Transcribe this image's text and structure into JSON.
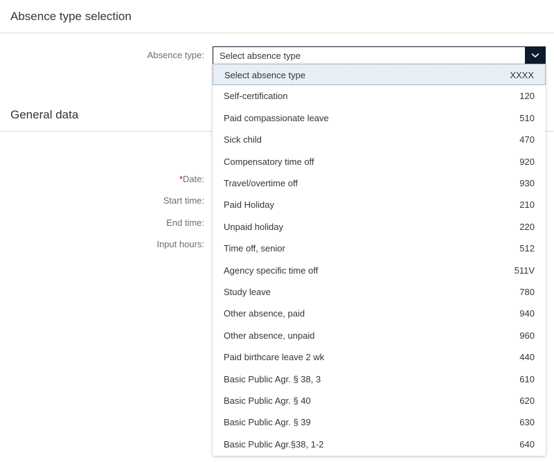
{
  "sections": {
    "absence_type_selection": "Absence type selection",
    "general_data": "General data"
  },
  "form": {
    "absence_type_label": "Absence type:",
    "date_required_marker": "*",
    "date_label": "Date:",
    "start_time_label": "Start time:",
    "end_time_label": "End time:",
    "input_hours_label": "Input hours:"
  },
  "absence_select": {
    "value": "Select absence type",
    "arrow_icon": "chevron-down-icon",
    "expanded": true,
    "options": [
      {
        "text": "Select absence type",
        "key": "XXXX",
        "selected": true
      },
      {
        "text": "Self-certification",
        "key": "120"
      },
      {
        "text": "Paid compassionate leave",
        "key": "510"
      },
      {
        "text": "Sick child",
        "key": "470"
      },
      {
        "text": "Compensatory time off",
        "key": "920"
      },
      {
        "text": "Travel/overtime off",
        "key": "930"
      },
      {
        "text": "Paid Holiday",
        "key": "210"
      },
      {
        "text": "Unpaid holiday",
        "key": "220"
      },
      {
        "text": "Time off, senior",
        "key": "512"
      },
      {
        "text": "Agency specific time off",
        "key": "511V"
      },
      {
        "text": "Study leave",
        "key": "780"
      },
      {
        "text": "Other absence, paid",
        "key": "940"
      },
      {
        "text": "Other absence, unpaid",
        "key": "960"
      },
      {
        "text": "Paid birthcare leave 2 wk",
        "key": "440"
      },
      {
        "text": "Basic Public Agr. § 38, 3",
        "key": "610"
      },
      {
        "text": "Basic Public Agr. § 40",
        "key": "620"
      },
      {
        "text": "Basic Public Agr. § 39",
        "key": "630"
      },
      {
        "text": "Basic Public Agr.§38, 1-2",
        "key": "640"
      }
    ]
  },
  "colors": {
    "required_marker": "#bb0000",
    "arrow_button": "#0c1a2b",
    "selected_option_bg": "#e8eff6"
  }
}
